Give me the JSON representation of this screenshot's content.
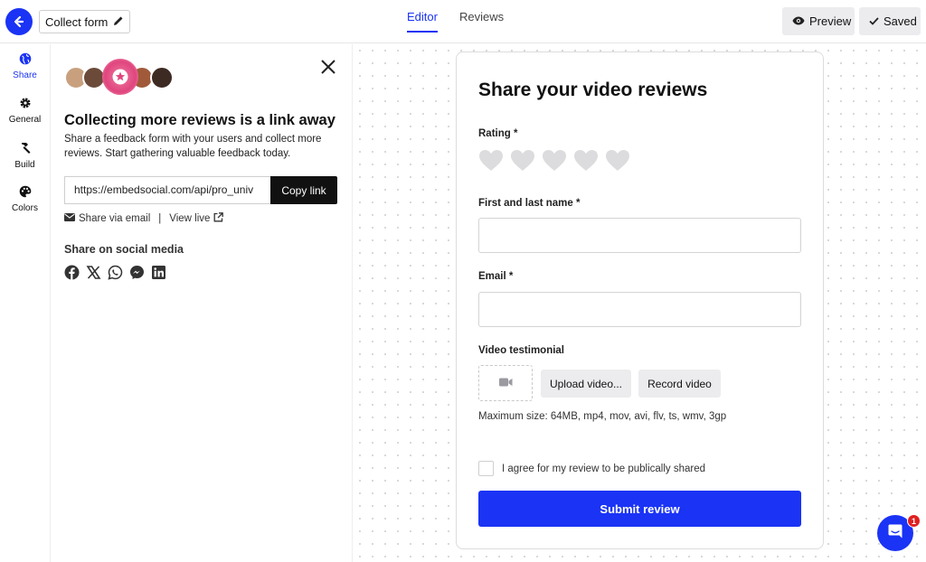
{
  "header": {
    "form_name": "Collect form",
    "tabs": [
      {
        "label": "Editor"
      },
      {
        "label": "Reviews"
      }
    ],
    "preview_label": "Preview",
    "saved_label": "Saved",
    "accent_color": "#1a33f5"
  },
  "sidebar": {
    "items": [
      {
        "label": "Share",
        "icon": "globe-icon"
      },
      {
        "label": "General",
        "icon": "gear-icon"
      },
      {
        "label": "Build",
        "icon": "hammer-icon"
      },
      {
        "label": "Colors",
        "icon": "palette-icon"
      }
    ]
  },
  "share_panel": {
    "title": "Collecting more reviews is a link away",
    "description": "Share a feedback form with your users and collect more reviews. Start gathering valuable feedback today.",
    "url": "https://embedsocial.com/api/pro_univ",
    "copy_label": "Copy link",
    "share_email_label": "Share via email",
    "separator": "|",
    "view_live_label": "View live",
    "social_title": "Share on social media",
    "social_icons": [
      "facebook-icon",
      "x-icon",
      "whatsapp-icon",
      "messenger-icon",
      "linkedin-icon"
    ]
  },
  "form": {
    "title": "Share your video reviews",
    "rating_label": "Rating *",
    "name_label": "First and last name *",
    "email_label": "Email *",
    "video_label": "Video testimonial",
    "upload_label": "Upload video...",
    "record_label": "Record video",
    "max_size": "Maximum size: 64MB, mp4, mov, avi, flv, ts, wmv, 3gp",
    "agree_label": "I agree for my review to be publically shared",
    "submit_label": "Submit review"
  },
  "chat": {
    "badge_count": "1"
  }
}
